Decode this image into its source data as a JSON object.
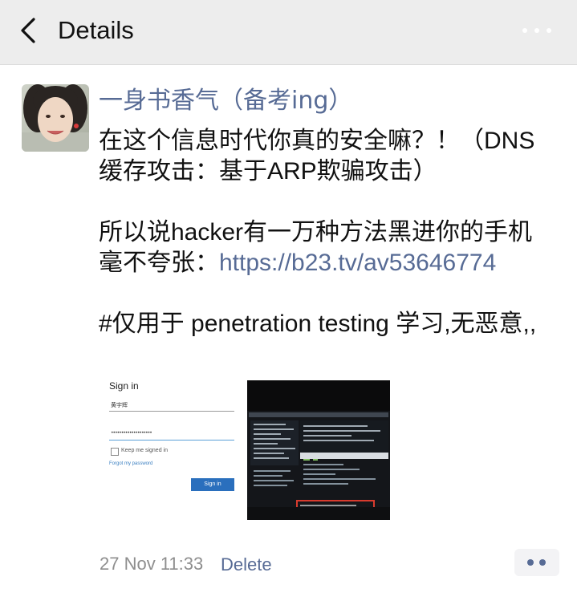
{
  "header": {
    "title": "Details",
    "back_icon": "chevron-left-icon",
    "more_icon": "more-dots-icon"
  },
  "post": {
    "nickname": "一身书香气（备考ing）",
    "paragraph1": "在这个信息时代你真的安全嘛？！（DNS缓存攻击：基于ARP欺骗攻击）",
    "paragraph2_text": "所以说hacker有一万种方法黑进你的手机毫不夸张：",
    "paragraph2_link": "https://b23.tv/av53646774",
    "paragraph3": "#仅用于 penetration testing 学习,无恶意,,",
    "images": {
      "signin": {
        "title": "Sign in",
        "username": "黄宇辉",
        "password_mask": "••••••••••••••••••••",
        "keep_signed_in": "Keep me signed in",
        "forgot_password": "Forgot my password",
        "button": "Sign in"
      }
    },
    "timestamp": "27 Nov 11:33",
    "delete_label": "Delete",
    "action_icon": "comment-dots-icon"
  },
  "colors": {
    "link": "#576b95",
    "header_bg": "#ededed",
    "text": "#111111",
    "meta": "#8e8e8e"
  }
}
